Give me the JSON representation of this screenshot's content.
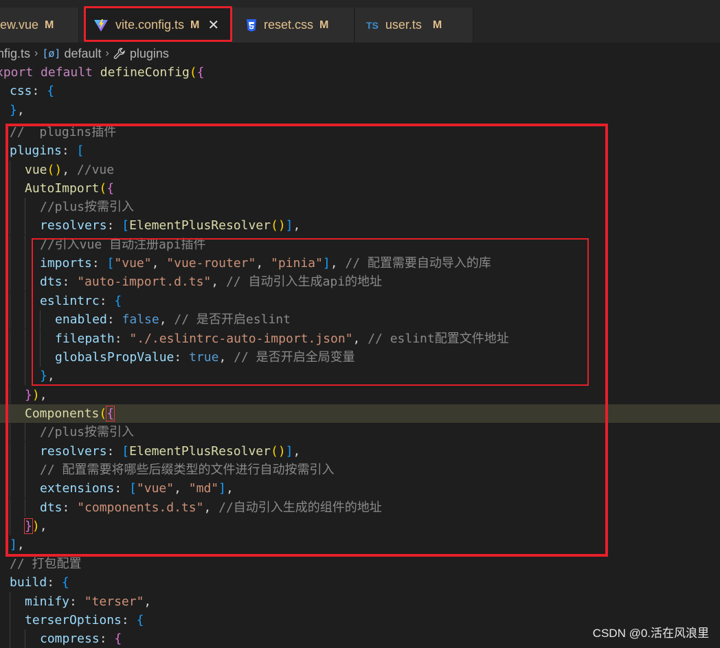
{
  "tabs": [
    {
      "name": "iew.vue",
      "modified": "M",
      "icon": "vue-icon"
    },
    {
      "name": "vite.config.ts",
      "modified": "M",
      "close": "✕",
      "icon": "vite-icon",
      "active": true
    },
    {
      "name": "reset.css",
      "modified": "M",
      "icon": "css-icon"
    },
    {
      "name": "user.ts",
      "modified": "M",
      "icon": "ts-icon",
      "icon_text": "TS"
    }
  ],
  "breadcrumb": {
    "file": "nfig.ts",
    "symbol_icon_text": "[ø]",
    "object": "default",
    "property": "plugins"
  },
  "code": {
    "l1": {
      "kw": "xport",
      "kw2": "default",
      "fn": "defineConfig",
      "p1": "(",
      "p2": "{"
    },
    "l2": {
      "prop": "css",
      "colon": ":",
      "brace": "{"
    },
    "l3": {
      "brace": "}",
      "comma": ","
    },
    "l4": {
      "cmt": "//  plugins插件"
    },
    "l5": {
      "prop": "plugins",
      "colon": ":",
      "br": "["
    },
    "l6": {
      "fn": "vue",
      "p": "()",
      "comma": ",",
      "cmt": "//vue"
    },
    "l7": {
      "fn": "AutoImport",
      "p": "(",
      "b": "{"
    },
    "l8": {
      "cmt": "//plus按需引入"
    },
    "l9": {
      "prop": "resolvers",
      "colon": ":",
      "br": "[",
      "fn": "ElementPlusResolver",
      "p": "()",
      "brc": "]",
      "comma": ","
    },
    "l10": {
      "cmt": "//引入vue 自动注册api插件"
    },
    "l11": {
      "prop": "imports",
      "colon": ":",
      "br": "[",
      "s1": "\"vue\"",
      "c1": ",",
      "s2": "\"vue-router\"",
      "c2": ",",
      "s3": "\"pinia\"",
      "brc": "]",
      "comma": ",",
      "cmt": "// 配置需要自动导入的库"
    },
    "l12": {
      "prop": "dts",
      "colon": ":",
      "str": "\"auto-import.d.ts\"",
      "comma": ",",
      "cmt": "// 自动引入生成api的地址"
    },
    "l13": {
      "prop": "eslintrc",
      "colon": ":",
      "brace": "{"
    },
    "l14": {
      "prop": "enabled",
      "colon": ":",
      "val": "false",
      "comma": ",",
      "cmt": "// 是否开启eslint"
    },
    "l15": {
      "prop": "filepath",
      "colon": ":",
      "str": "\"./.eslintrc-auto-import.json\"",
      "comma": ",",
      "cmt": "// eslint配置文件地址"
    },
    "l16": {
      "prop": "globalsPropValue",
      "colon": ":",
      "val": "true",
      "comma": ",",
      "cmt": "// 是否开启全局变量"
    },
    "l17": {
      "brace": "}",
      "comma": ","
    },
    "l18": {
      "b": "}",
      "p": ")",
      "comma": ","
    },
    "l19": {
      "fn": "Components",
      "p": "(",
      "b": "{"
    },
    "l20": {
      "cmt": "//plus按需引入"
    },
    "l21": {
      "prop": "resolvers",
      "colon": ":",
      "br": "[",
      "fn": "ElementPlusResolver",
      "p": "()",
      "brc": "]",
      "comma": ","
    },
    "l22": {
      "cmt": "// 配置需要将哪些后缀类型的文件进行自动按需引入"
    },
    "l23": {
      "prop": "extensions",
      "colon": ":",
      "br": "[",
      "s1": "\"vue\"",
      "c1": ",",
      "s2": "\"md\"",
      "brc": "]",
      "comma": ","
    },
    "l24": {
      "prop": "dts",
      "colon": ":",
      "str": "\"components.d.ts\"",
      "comma": ",",
      "cmt": "//自动引入生成的组件的地址"
    },
    "l25": {
      "b": "}",
      "p": ")",
      "comma": ","
    },
    "l26": {
      "br": "]",
      "comma": ","
    },
    "l27": {
      "cmt": "// 打包配置"
    },
    "l28": {
      "prop": "build",
      "colon": ":",
      "brace": "{"
    },
    "l29": {
      "prop": "minify",
      "colon": ":",
      "str": "\"terser\"",
      "comma": ","
    },
    "l30": {
      "prop": "terserOptions",
      "colon": ":",
      "brace": "{"
    },
    "l31": {
      "prop": "compress",
      "colon": ":",
      "brace": "{"
    }
  },
  "watermark": "CSDN @0.活在风浪里",
  "colors": {
    "annotation": "#e6202a",
    "current_line": "#3a3a2e",
    "tab_text": "#e2c08d"
  }
}
